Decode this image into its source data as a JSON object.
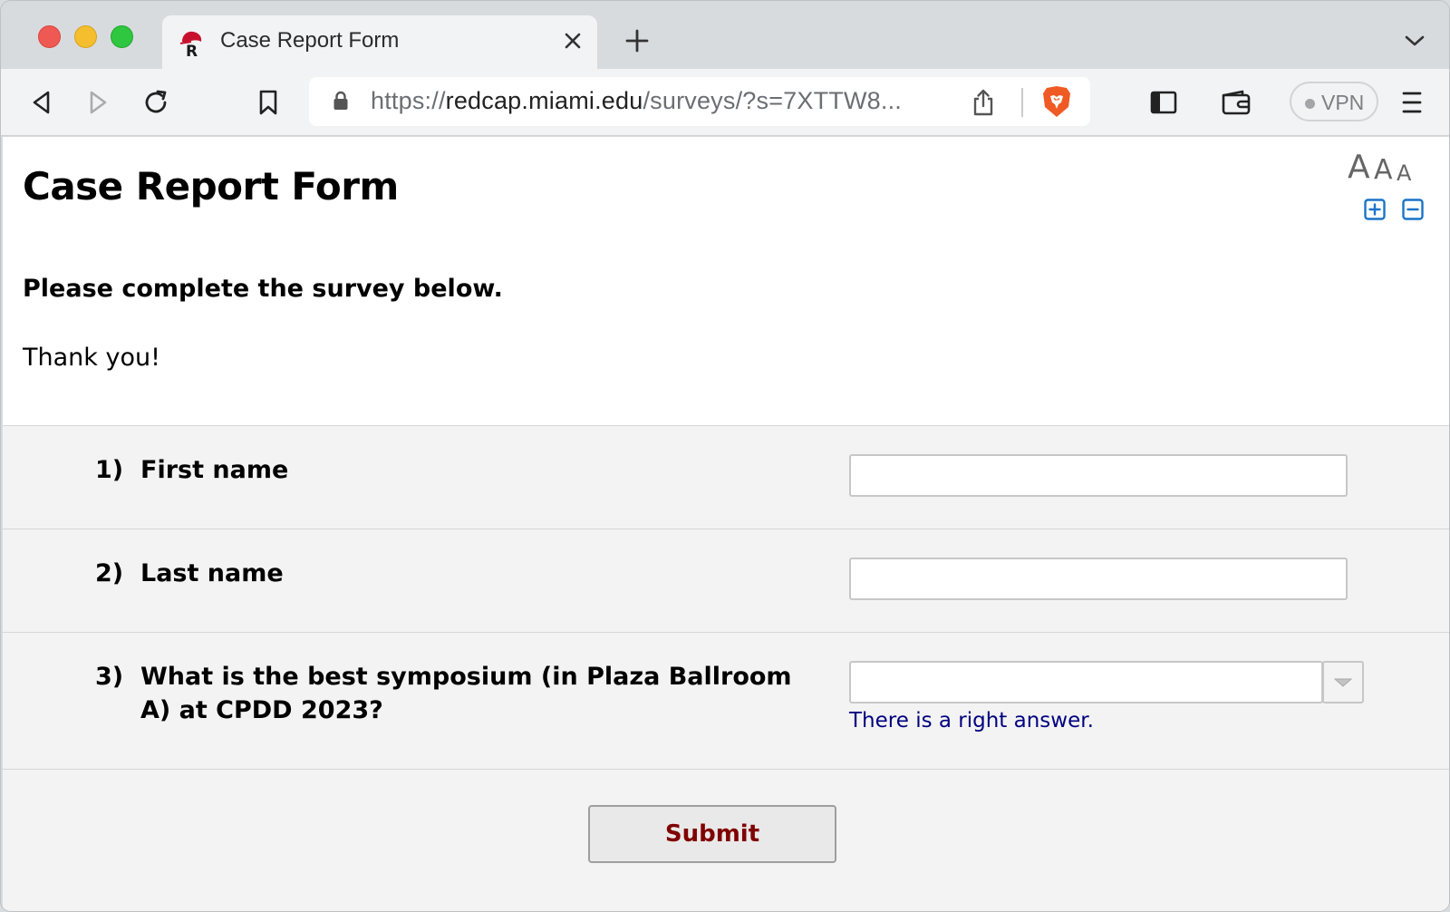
{
  "browser": {
    "tab": {
      "title": "Case Report Form",
      "favicon": "redcap-favicon-icon"
    },
    "url": {
      "protocol": "https://",
      "host": "redcap.miami.edu",
      "path": "/surveys/?s=7XTTW8..."
    },
    "vpn_label": "VPN",
    "icons": [
      "back-icon",
      "forward-icon",
      "reload-icon",
      "bookmark-icon",
      "lock-icon",
      "share-icon",
      "brave-shield-icon",
      "sidebar-icon",
      "wallet-icon",
      "menu-icon"
    ],
    "colors": {
      "close": "#ee5a53",
      "minimize": "#f5be2f",
      "maximize": "#2fc640",
      "brave": "#f05a24"
    }
  },
  "page": {
    "title": "Case Report Form",
    "font_size_labels": [
      "A",
      "A",
      "A"
    ],
    "intro_bold": "Please complete the survey below.",
    "intro_thanks": "Thank you!",
    "questions": [
      {
        "number": "1)",
        "label": "First name",
        "value": ""
      },
      {
        "number": "2)",
        "label": "Last name",
        "value": ""
      },
      {
        "number": "3)",
        "label": "What is the best symposium (in Plaza Ballroom A) at CPDD 2023?",
        "value": "",
        "note": "There is a right answer."
      }
    ],
    "submit_label": "Submit",
    "colors": {
      "note": "#000080",
      "submit_text": "#800000",
      "zoom_icons": "#1a73c9"
    }
  }
}
